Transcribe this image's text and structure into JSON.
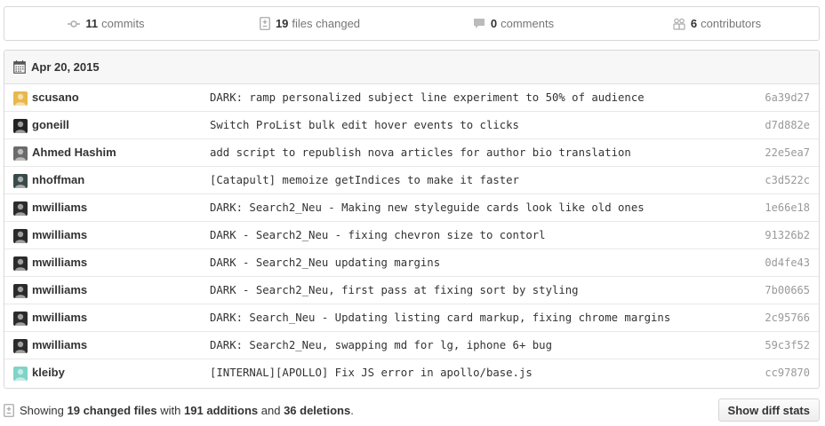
{
  "summary": {
    "commits": {
      "count": "11",
      "label": "commits",
      "icon": "commit-icon"
    },
    "files": {
      "count": "19",
      "label": "files changed",
      "icon": "file-diff-icon"
    },
    "comments": {
      "count": "0",
      "label": "comments",
      "icon": "comment-icon"
    },
    "contributors": {
      "count": "6",
      "label": "contributors",
      "icon": "organization-icon"
    }
  },
  "group": {
    "date": "Apr 20, 2015",
    "commits": [
      {
        "author": "scusano",
        "message": "DARK: ramp personalized subject line experiment to 50% of audience",
        "sha": "6a39d27",
        "avatar_color": "#e8b84a"
      },
      {
        "author": "goneill",
        "message": "Switch ProList bulk edit hover events to clicks",
        "sha": "d7d882e",
        "avatar_color": "#222222"
      },
      {
        "author": "Ahmed Hashim",
        "message": "add script to republish nova articles for author bio translation",
        "sha": "22e5ea7",
        "avatar_color": "#6b6b6b"
      },
      {
        "author": "nhoffman",
        "message": "[Catapult] memoize getIndices to make it faster",
        "sha": "c3d522c",
        "avatar_color": "#3a4a4a"
      },
      {
        "author": "mwilliams",
        "message": "DARK: Search2_Neu - Making new styleguide cards look like old ones",
        "sha": "1e66e18",
        "avatar_color": "#2b2b2b"
      },
      {
        "author": "mwilliams",
        "message": "DARK - Search2_Neu - fixing chevron size to contorl",
        "sha": "91326b2",
        "avatar_color": "#2b2b2b"
      },
      {
        "author": "mwilliams",
        "message": "DARK - Search2_Neu updating margins",
        "sha": "0d4fe43",
        "avatar_color": "#2b2b2b"
      },
      {
        "author": "mwilliams",
        "message": "DARK - Search2_Neu, first pass at fixing sort by styling",
        "sha": "7b00665",
        "avatar_color": "#2b2b2b"
      },
      {
        "author": "mwilliams",
        "message": "DARK: Search_Neu - Updating listing card markup, fixing chrome margins",
        "sha": "2c95766",
        "avatar_color": "#2b2b2b"
      },
      {
        "author": "mwilliams",
        "message": "DARK: Search2_Neu, swapping md for lg, iphone 6+ bug",
        "sha": "59c3f52",
        "avatar_color": "#2b2b2b"
      },
      {
        "author": "kleiby",
        "message": "[INTERNAL][APOLLO] Fix JS error in apollo/base.js",
        "sha": "cc97870",
        "avatar_color": "#7fd3c7"
      }
    ]
  },
  "footer": {
    "prefix": "Showing",
    "files": "19 changed files",
    "with": "with",
    "additions": "191 additions",
    "and": "and",
    "deletions": "36 deletions",
    "period": ".",
    "button_label": "Show diff stats"
  }
}
